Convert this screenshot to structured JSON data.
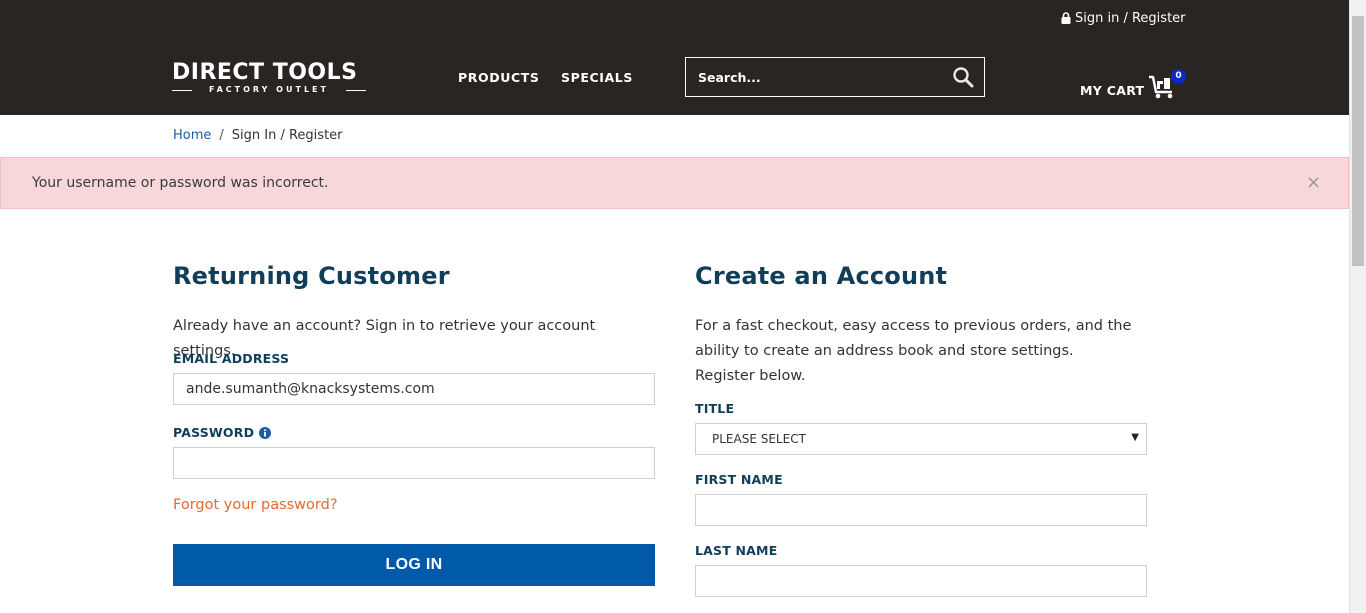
{
  "header": {
    "signin_text": "Sign in / Register",
    "logo_main": "DIRECT TOOLS",
    "logo_sub": "FACTORY OUTLET",
    "nav": [
      "PRODUCTS",
      "SPECIALS"
    ],
    "search_placeholder": "Search...",
    "cart_label": "MY CART",
    "cart_count": "0",
    "icons": [
      "lock-icon",
      "search-icon",
      "cart-icon"
    ]
  },
  "breadcrumb": {
    "home": "Home",
    "separator": "/",
    "current": "Sign In / Register"
  },
  "alert": {
    "message": "Your username or password was incorrect.",
    "close": "×"
  },
  "returning": {
    "title": "Returning Customer",
    "intro": "Already have an account? Sign in to retrieve your account settings.",
    "email_label": "EMAIL ADDRESS",
    "email_value": "ande.sumanth@knacksystems.com",
    "password_label": "PASSWORD",
    "password_value": "",
    "forgot": "Forgot your password?",
    "login_button": "LOG IN"
  },
  "create": {
    "title": "Create an Account",
    "intro": "For a fast checkout, easy access to previous orders, and the ability to create an address book and store settings. Register below.",
    "title_label": "TITLE",
    "title_select": "PLEASE SELECT",
    "first_name_label": "FIRST NAME",
    "last_name_label": "LAST NAME"
  },
  "colors": {
    "header_bg": "#2a2422",
    "heading": "#103e58",
    "link": "#1a5fa6",
    "forgot_link": "#e56a2d",
    "button": "#005aa9",
    "alert_bg": "#f8d7da",
    "badge": "#0a29c8"
  }
}
